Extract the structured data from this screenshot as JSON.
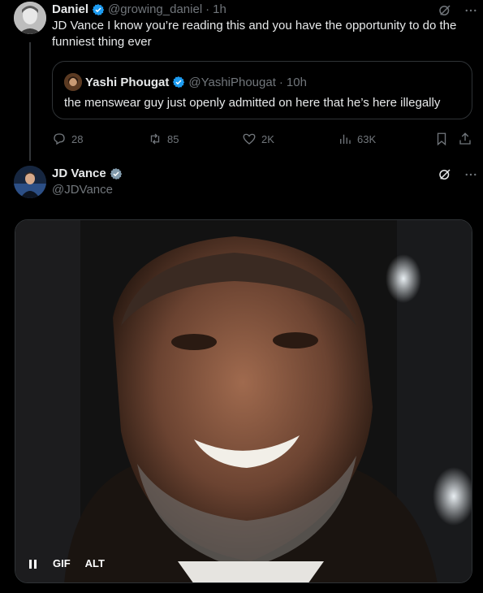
{
  "reply_tweet": {
    "display_name": "Daniel",
    "handle": "@growing_daniel",
    "separator": "·",
    "time": "1h",
    "text": "JD Vance I know you’re reading this and you have the opportunity to do the funniest thing ever",
    "quoted_tweet": {
      "display_name": "Yashi Phougat",
      "handle": "@YashiPhougat",
      "separator": "·",
      "time": "10h",
      "text": "the menswear guy just openly admitted on here that he’s here illegally"
    },
    "actions": {
      "replies": "28",
      "reposts": "85",
      "likes": "2K",
      "views": "63K"
    }
  },
  "main_tweet": {
    "display_name": "JD Vance",
    "handle": "@JDVance",
    "media": {
      "gif_label": "GIF",
      "alt_label": "ALT"
    }
  },
  "colors": {
    "background": "#000000",
    "text": "#e7e9ea",
    "muted": "#71767b",
    "verified": "#1d9bf0",
    "border": "#2f3336"
  },
  "icons": {
    "verified": "verified-badge-icon",
    "grok": "grok-icon",
    "more": "more-icon",
    "reply": "reply-icon",
    "repost": "repost-icon",
    "like": "like-icon",
    "views": "views-icon",
    "bookmark": "bookmark-icon",
    "share": "share-icon",
    "pause": "pause-icon"
  }
}
